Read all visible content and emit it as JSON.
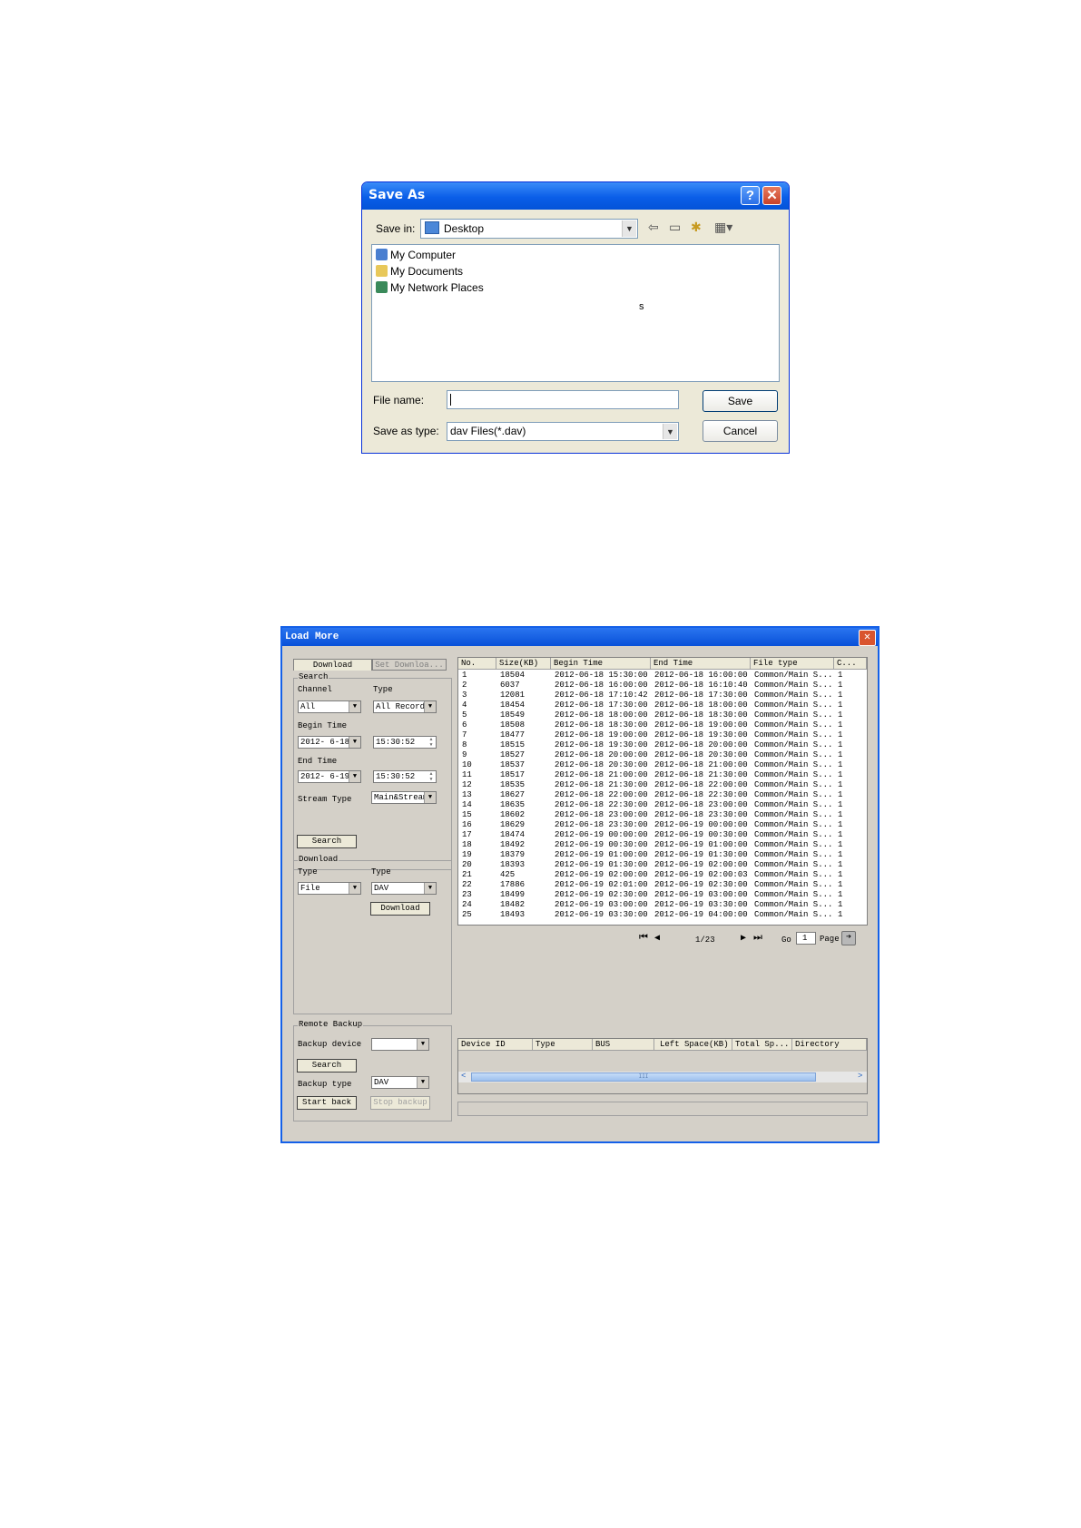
{
  "save_dialog": {
    "title": "Save As",
    "help_glyph": "?",
    "close_glyph": "✕",
    "save_in_label": "Save in:",
    "save_in_value": "Desktop",
    "toolbar_icons": [
      "back-icon",
      "up-folder-icon",
      "new-folder-icon",
      "view-menu-icon"
    ],
    "items": [
      {
        "label": "My Computer",
        "icon": "computer-icon",
        "color": "#4a7fd0"
      },
      {
        "label": "My Documents",
        "icon": "documents-folder-icon",
        "color": "#e8c85a"
      },
      {
        "label": "My Network Places",
        "icon": "network-icon",
        "color": "#3a8a5a"
      }
    ],
    "stray_glyph": "s",
    "file_name_label": "File name:",
    "file_name_value": "",
    "save_as_type_label": "Save as type:",
    "save_as_type_value": "dav Files(*.dav)",
    "save_button": "Save",
    "cancel_button": "Cancel"
  },
  "load_more": {
    "title": "Load More",
    "close_glyph": "✕",
    "tabs": [
      "Download",
      "Set Downloa..."
    ],
    "search": {
      "group": "Search",
      "channel_label": "Channel",
      "channel_value": "All",
      "type_label": "Type",
      "type_value": "All Records",
      "begin_label": "Begin Time",
      "begin_date": "2012- 6-18",
      "begin_time": "15:30:52",
      "end_label": "End Time",
      "end_date": "2012- 6-19",
      "end_time": "15:30:52",
      "stream_label": "Stream Type",
      "stream_value": "Main&Stream",
      "search_button": "Search"
    },
    "download": {
      "group": "Download",
      "type1_label": "Type",
      "type1_value": "File",
      "type2_label": "Type",
      "type2_value": "DAV",
      "download_button": "Download"
    },
    "remote_backup": {
      "group": "Remote Backup",
      "device_label": "Backup device",
      "device_value": "",
      "search_button": "Search",
      "backup_type_label": "Backup type",
      "backup_type_value": "DAV",
      "start_button": "Start back",
      "stop_button": "Stop backup"
    },
    "table": {
      "headers": [
        "No.",
        "Size(KB)",
        "Begin Time",
        "End Time",
        "File type",
        "C..."
      ],
      "rows": [
        [
          "1",
          "18504",
          "2012-06-18 15:30:00",
          "2012-06-18 16:00:00",
          "Common/Main S...",
          "1"
        ],
        [
          "2",
          "6037",
          "2012-06-18 16:00:00",
          "2012-06-18 16:10:40",
          "Common/Main S...",
          "1"
        ],
        [
          "3",
          "12081",
          "2012-06-18 17:10:42",
          "2012-06-18 17:30:00",
          "Common/Main S...",
          "1"
        ],
        [
          "4",
          "18454",
          "2012-06-18 17:30:00",
          "2012-06-18 18:00:00",
          "Common/Main S...",
          "1"
        ],
        [
          "5",
          "18549",
          "2012-06-18 18:00:00",
          "2012-06-18 18:30:00",
          "Common/Main S...",
          "1"
        ],
        [
          "6",
          "18508",
          "2012-06-18 18:30:00",
          "2012-06-18 19:00:00",
          "Common/Main S...",
          "1"
        ],
        [
          "7",
          "18477",
          "2012-06-18 19:00:00",
          "2012-06-18 19:30:00",
          "Common/Main S...",
          "1"
        ],
        [
          "8",
          "18515",
          "2012-06-18 19:30:00",
          "2012-06-18 20:00:00",
          "Common/Main S...",
          "1"
        ],
        [
          "9",
          "18527",
          "2012-06-18 20:00:00",
          "2012-06-18 20:30:00",
          "Common/Main S...",
          "1"
        ],
        [
          "10",
          "18537",
          "2012-06-18 20:30:00",
          "2012-06-18 21:00:00",
          "Common/Main S...",
          "1"
        ],
        [
          "11",
          "18517",
          "2012-06-18 21:00:00",
          "2012-06-18 21:30:00",
          "Common/Main S...",
          "1"
        ],
        [
          "12",
          "18535",
          "2012-06-18 21:30:00",
          "2012-06-18 22:00:00",
          "Common/Main S...",
          "1"
        ],
        [
          "13",
          "18627",
          "2012-06-18 22:00:00",
          "2012-06-18 22:30:00",
          "Common/Main S...",
          "1"
        ],
        [
          "14",
          "18635",
          "2012-06-18 22:30:00",
          "2012-06-18 23:00:00",
          "Common/Main S...",
          "1"
        ],
        [
          "15",
          "18602",
          "2012-06-18 23:00:00",
          "2012-06-18 23:30:00",
          "Common/Main S...",
          "1"
        ],
        [
          "16",
          "18629",
          "2012-06-18 23:30:00",
          "2012-06-19 00:00:00",
          "Common/Main S...",
          "1"
        ],
        [
          "17",
          "18474",
          "2012-06-19 00:00:00",
          "2012-06-19 00:30:00",
          "Common/Main S...",
          "1"
        ],
        [
          "18",
          "18492",
          "2012-06-19 00:30:00",
          "2012-06-19 01:00:00",
          "Common/Main S...",
          "1"
        ],
        [
          "19",
          "18379",
          "2012-06-19 01:00:00",
          "2012-06-19 01:30:00",
          "Common/Main S...",
          "1"
        ],
        [
          "20",
          "18393",
          "2012-06-19 01:30:00",
          "2012-06-19 02:00:00",
          "Common/Main S...",
          "1"
        ],
        [
          "21",
          "425",
          "2012-06-19 02:00:00",
          "2012-06-19 02:00:03",
          "Common/Main S...",
          "1"
        ],
        [
          "22",
          "17886",
          "2012-06-19 02:01:00",
          "2012-06-19 02:30:00",
          "Common/Main S...",
          "1"
        ],
        [
          "23",
          "18499",
          "2012-06-19 02:30:00",
          "2012-06-19 03:00:00",
          "Common/Main S...",
          "1"
        ],
        [
          "24",
          "18482",
          "2012-06-19 03:00:00",
          "2012-06-19 03:30:00",
          "Common/Main S...",
          "1"
        ],
        [
          "25",
          "18493",
          "2012-06-19 03:30:00",
          "2012-06-19 04:00:00",
          "Common/Main S...",
          "1"
        ]
      ]
    },
    "pager": {
      "first": "⏮",
      "prev": "◀",
      "page_indicator": "1/23",
      "next": "▶",
      "last": "⏭",
      "go_label": "Go",
      "page_value": "1",
      "page_label": "Page",
      "go_glyph": "➔"
    },
    "device_table": {
      "headers": [
        "Device ID",
        "Type",
        "BUS",
        "Left Space(KB)",
        "Total Sp...",
        "Directory"
      ],
      "scroll_left": "<",
      "scroll_right": ">",
      "scroll_grip": "III"
    }
  }
}
